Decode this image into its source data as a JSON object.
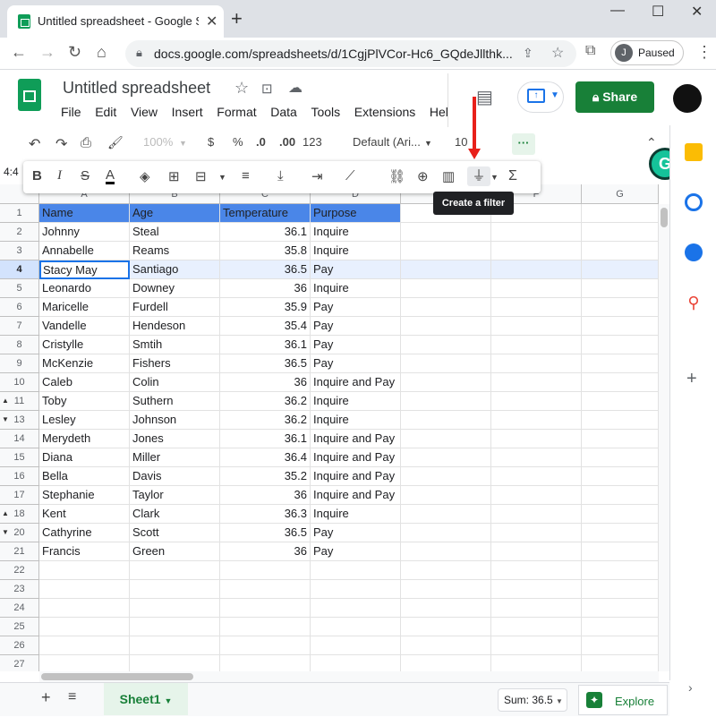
{
  "browser": {
    "tab_title": "Untitled spreadsheet - Google Sh",
    "url": "docs.google.com/spreadsheets/d/1CgjPlVCor-Hc6_GQdeJllthk...",
    "profile_initial": "J",
    "profile_status": "Paused"
  },
  "doc": {
    "title": "Untitled spreadsheet",
    "menus": [
      "File",
      "Edit",
      "View",
      "Insert",
      "Format",
      "Data",
      "Tools",
      "Extensions",
      "Hel"
    ],
    "share_label": "Share"
  },
  "toolbar": {
    "zoom": "100%",
    "currency": "$",
    "percent": "%",
    "dec_less": ".0",
    "dec_more": ".00",
    "more_formats": "123",
    "font": "Default (Ari...",
    "font_size": "10"
  },
  "floating": {
    "tooltip": "Create a filter"
  },
  "namebox": "4:4",
  "columns": [
    "A",
    "B",
    "C",
    "D",
    "E",
    "F",
    "G"
  ],
  "rows": [
    {
      "n": "1",
      "a": "Name",
      "b": "Age",
      "c": "Temperature",
      "d": "Purpose"
    },
    {
      "n": "2",
      "a": "Johnny",
      "b": "Steal",
      "c": "36.1",
      "d": "Inquire"
    },
    {
      "n": "3",
      "a": "Annabelle",
      "b": "Reams",
      "c": "35.8",
      "d": "Inquire"
    },
    {
      "n": "4",
      "a": "Stacy May",
      "b": "Santiago",
      "c": "36.5",
      "d": "Pay"
    },
    {
      "n": "5",
      "a": "Leonardo",
      "b": "Downey",
      "c": "36",
      "d": "Inquire"
    },
    {
      "n": "6",
      "a": "Maricelle",
      "b": "Furdell",
      "c": "35.9",
      "d": "Pay"
    },
    {
      "n": "7",
      "a": "Vandelle",
      "b": "Hendeson",
      "c": "35.4",
      "d": "Pay"
    },
    {
      "n": "8",
      "a": "Cristylle",
      "b": "Smtih",
      "c": "36.1",
      "d": "Pay"
    },
    {
      "n": "9",
      "a": "McKenzie",
      "b": "Fishers",
      "c": "36.5",
      "d": "Pay"
    },
    {
      "n": "10",
      "a": "Caleb",
      "b": "Colin",
      "c": "36",
      "d": "Inquire and Pay"
    },
    {
      "n": "11",
      "a": "Toby",
      "b": "Suthern",
      "c": "36.2",
      "d": "Inquire"
    },
    {
      "n": "13",
      "a": "Lesley",
      "b": "Johnson",
      "c": "36.2",
      "d": "Inquire"
    },
    {
      "n": "14",
      "a": "Merydeth",
      "b": "Jones",
      "c": "36.1",
      "d": "Inquire and Pay"
    },
    {
      "n": "15",
      "a": "Diana",
      "b": "Miller",
      "c": "36.4",
      "d": "Inquire and Pay"
    },
    {
      "n": "16",
      "a": "Bella",
      "b": "Davis",
      "c": "35.2",
      "d": "Inquire and Pay"
    },
    {
      "n": "17",
      "a": "Stephanie",
      "b": "Taylor",
      "c": "36",
      "d": "Inquire and Pay"
    },
    {
      "n": "18",
      "a": "Kent",
      "b": "Clark",
      "c": "36.3",
      "d": "Inquire"
    },
    {
      "n": "20",
      "a": "Cathyrine",
      "b": "Scott",
      "c": "36.5",
      "d": "Pay"
    },
    {
      "n": "21",
      "a": "Francis",
      "b": "Green",
      "c": "36",
      "d": "Pay"
    },
    {
      "n": "22",
      "a": "",
      "b": "",
      "c": "",
      "d": ""
    },
    {
      "n": "23",
      "a": "",
      "b": "",
      "c": "",
      "d": ""
    },
    {
      "n": "24",
      "a": "",
      "b": "",
      "c": "",
      "d": ""
    },
    {
      "n": "25",
      "a": "",
      "b": "",
      "c": "",
      "d": ""
    },
    {
      "n": "26",
      "a": "",
      "b": "",
      "c": "",
      "d": ""
    },
    {
      "n": "27",
      "a": "",
      "b": "",
      "c": "",
      "d": ""
    }
  ],
  "bottom": {
    "sheet_tab": "Sheet1",
    "sum": "Sum: 36.5",
    "explore": "Explore"
  },
  "colors": {
    "header_fill": "#4a86e8",
    "share": "#188038",
    "arrow": "#e8201a"
  }
}
